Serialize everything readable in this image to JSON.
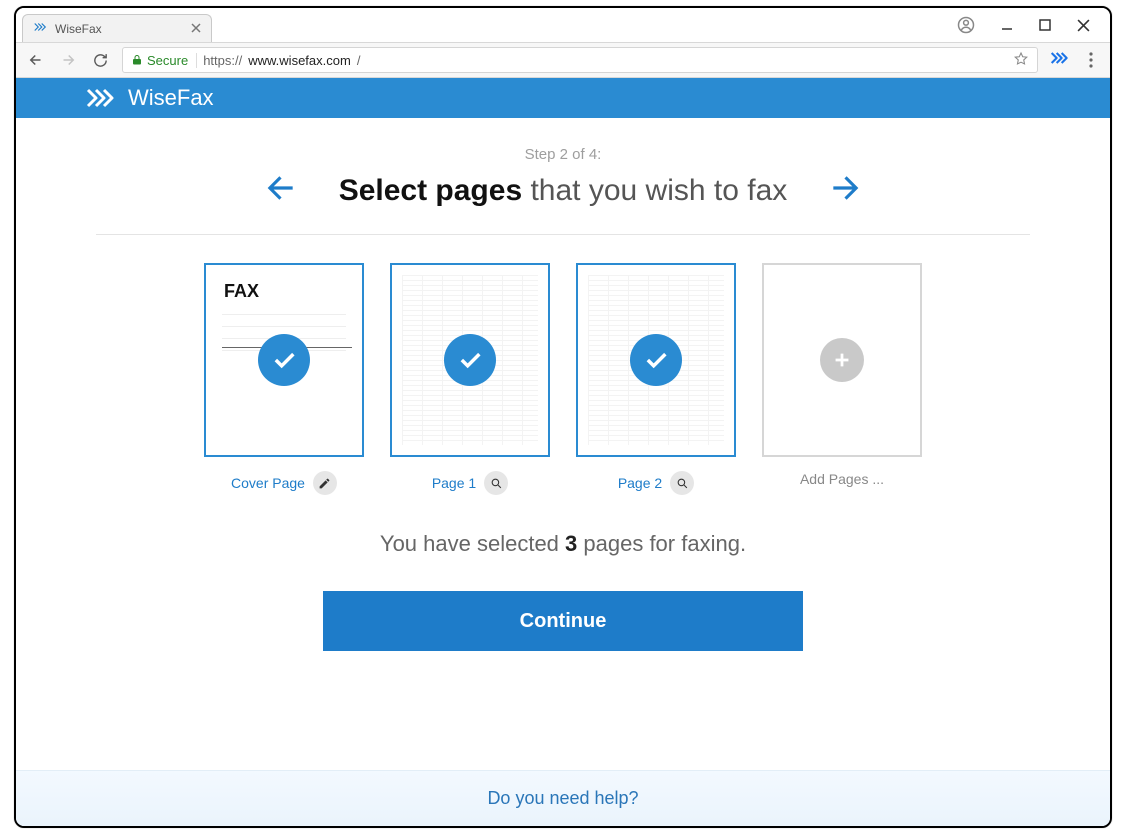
{
  "browser": {
    "tab_title": "WiseFax",
    "secure_label": "Secure",
    "url_prefix": "https://",
    "url_host": "www.wisefax.com",
    "url_path": "/"
  },
  "header": {
    "brand": "WiseFax"
  },
  "step": {
    "label": "Step 2 of 4:",
    "headline_bold": "Select pages",
    "headline_rest": " that you wish to fax"
  },
  "thumbs": [
    {
      "label": "Cover Page",
      "action_icon": "edit",
      "fax_title": "FAX"
    },
    {
      "label": "Page 1",
      "action_icon": "zoom"
    },
    {
      "label": "Page 2",
      "action_icon": "zoom"
    }
  ],
  "add_label": "Add Pages ...",
  "selection": {
    "prefix": "You have selected ",
    "count": "3",
    "suffix": " pages for faxing."
  },
  "continue_label": "Continue",
  "help_label": "Do you need help?"
}
